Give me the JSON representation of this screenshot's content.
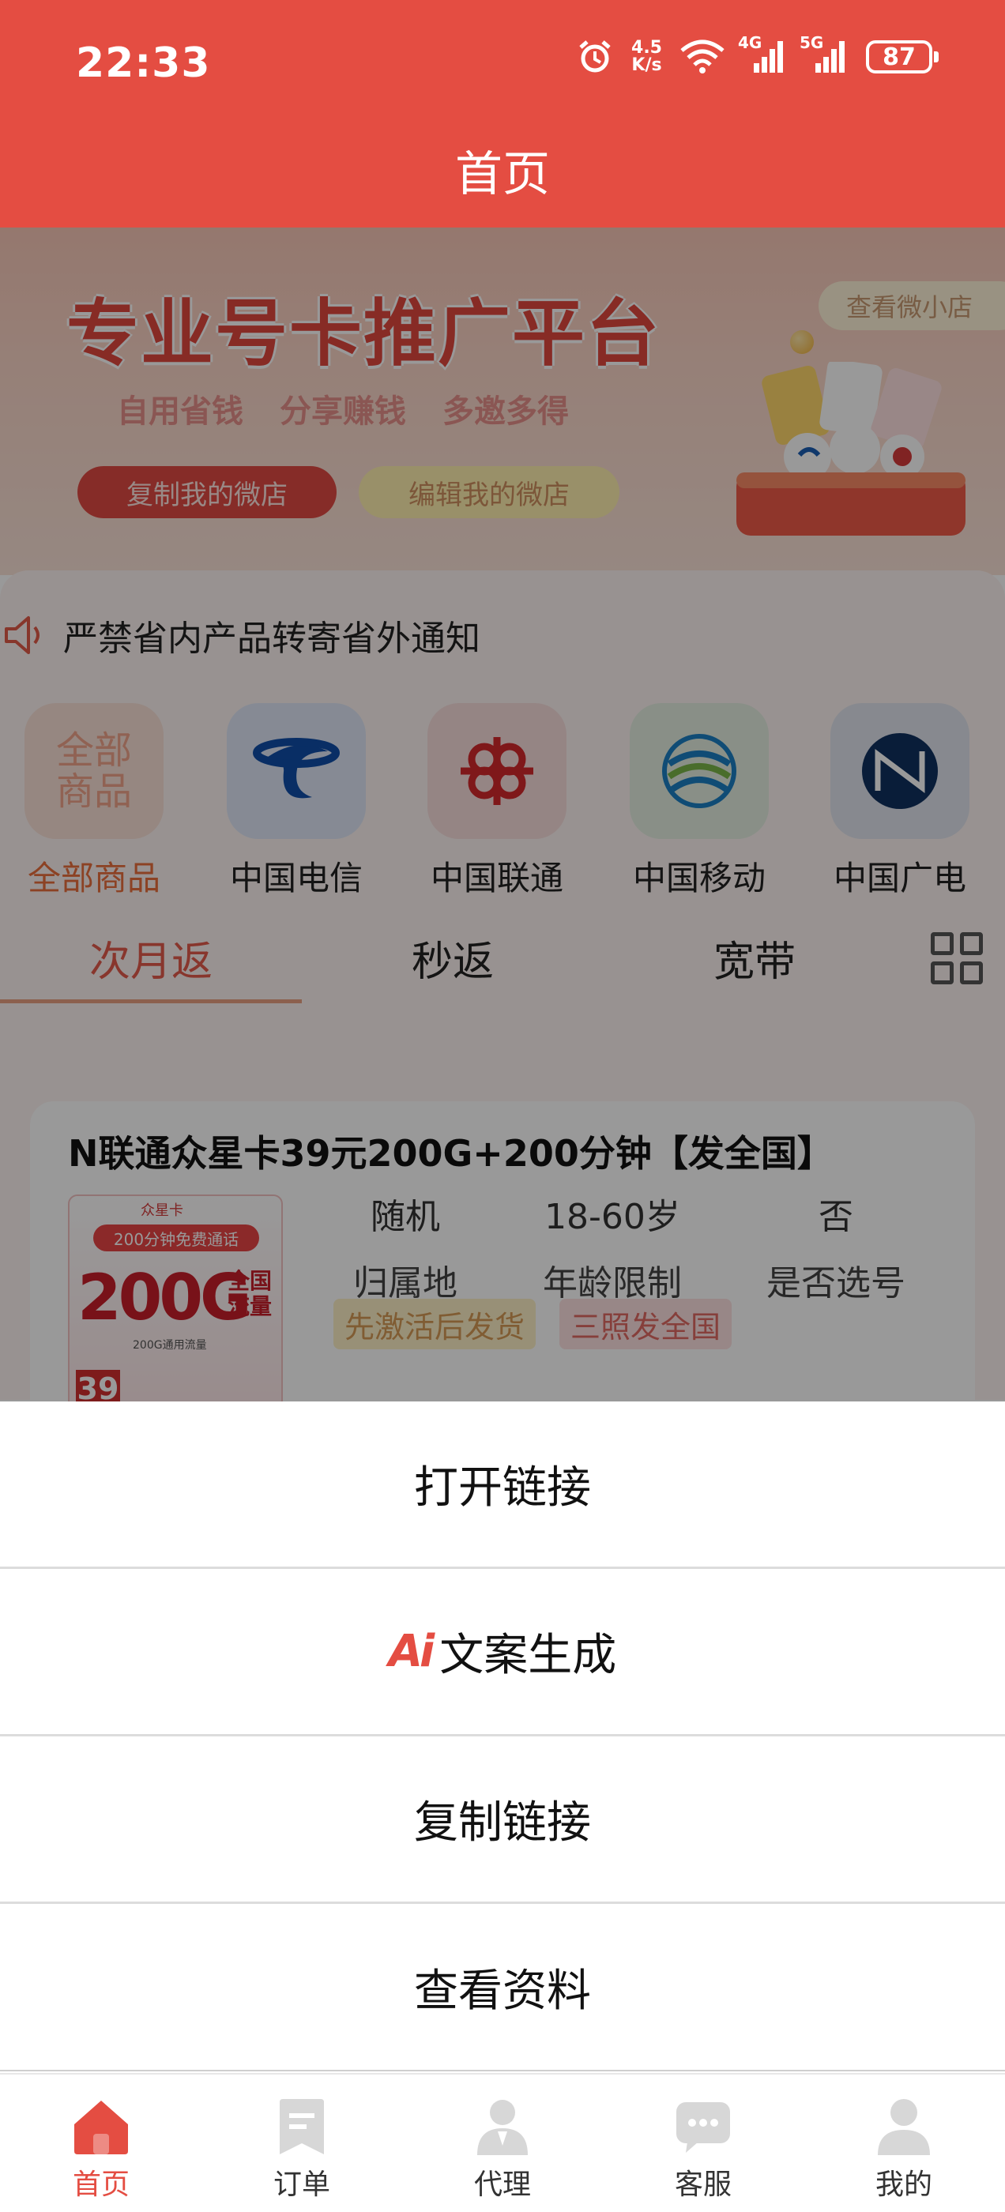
{
  "status_bar": {
    "time": "22:33",
    "net_speed_value": "4.5",
    "net_speed_unit": "K/s",
    "sim1_tag": "4G",
    "sim2_tag": "5G",
    "battery": "87",
    "icons": [
      "alarm-icon",
      "wifi-icon",
      "signal-4g-icon",
      "signal-5g-icon",
      "battery-icon"
    ]
  },
  "header": {
    "title": "首页"
  },
  "banner": {
    "title": "专业号卡推广平台",
    "slogans": [
      "自用省钱",
      "分享赚钱",
      "多邀多得"
    ],
    "copy_shop_label": "复制我的微店",
    "edit_shop_label": "编辑我的微店",
    "view_shop_label": "查看微小店"
  },
  "notice": {
    "text": "严禁省内产品转寄省外通知"
  },
  "carriers": [
    {
      "label": "全部商品",
      "logo_text": "全部商品",
      "active": true
    },
    {
      "label": "中国电信"
    },
    {
      "label": "中国联通"
    },
    {
      "label": "中国移动"
    },
    {
      "label": "中国广电"
    }
  ],
  "tabs": [
    {
      "label": "次月返",
      "active": true
    },
    {
      "label": "秒返"
    },
    {
      "label": "宽带"
    }
  ],
  "product": {
    "title": "N联通众星卡39元200G+200分钟【发全国】",
    "image_text": {
      "top": "200分钟免费通话",
      "big": "200G",
      "side": "全国流量",
      "sub": "200G通用流量",
      "price": "39",
      "card_name": "众星卡"
    },
    "specs": [
      {
        "value": "随机",
        "key": "归属地"
      },
      {
        "value": "18-60岁",
        "key": "年龄限制"
      },
      {
        "value": "否",
        "key": "是否选号"
      }
    ],
    "badges": [
      "先激活后发货",
      "三照发全国"
    ]
  },
  "action_sheet": {
    "items": [
      {
        "label": "打开链接"
      },
      {
        "label": "文案生成",
        "prefix": "Ai"
      },
      {
        "label": "复制链接"
      },
      {
        "label": "查看资料"
      }
    ]
  },
  "bottom_nav": [
    {
      "label": "首页",
      "active": true
    },
    {
      "label": "订单"
    },
    {
      "label": "代理"
    },
    {
      "label": "客服"
    },
    {
      "label": "我的"
    }
  ],
  "colors": {
    "brand": "#e44d42",
    "active_tab": "#e35a4b",
    "carrier_active": "#e96f3d"
  }
}
